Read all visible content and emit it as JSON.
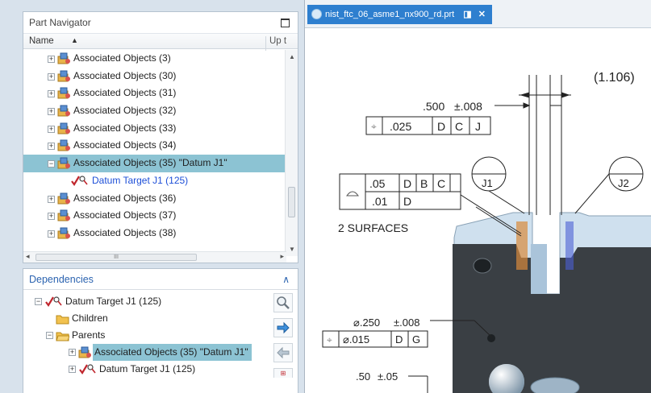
{
  "part_navigator": {
    "title": "Part Navigator",
    "columns": {
      "name": "Name",
      "sort_indicator": "▲",
      "up_to_date": "Up t"
    },
    "rows": [
      {
        "label": "Associated Objects (3)"
      },
      {
        "label": "Associated Objects (30)"
      },
      {
        "label": "Associated Objects (31)"
      },
      {
        "label": "Associated Objects (32)"
      },
      {
        "label": "Associated Objects (33)"
      },
      {
        "label": "Associated Objects (34)"
      },
      {
        "label": "Associated Objects (35) \"Datum J1\""
      },
      {
        "label": "Datum Target J1 (125)"
      },
      {
        "label": "Associated Objects (36)"
      },
      {
        "label": "Associated Objects (37)"
      },
      {
        "label": "Associated Objects (38)"
      }
    ],
    "hscroll_thumb": "III"
  },
  "dependencies": {
    "title": "Dependencies",
    "rows": [
      {
        "label": "Datum Target J1 (125)"
      },
      {
        "label": "Children"
      },
      {
        "label": "Parents"
      },
      {
        "label": "Associated Objects (35) \"Datum J1\""
      },
      {
        "label": "Datum Target J1 (125)"
      }
    ]
  },
  "editor": {
    "tab_title": "nist_ftc_06_asme1_nx900_rd.prt"
  },
  "drawing": {
    "dim_1106": "(1.106)",
    "dim_500": ".500",
    "tol_500": "±.008",
    "fcf1_value": ".025",
    "fcf1_d": "D",
    "fcf1_c": "C",
    "fcf1_j": "J",
    "fcf2_val1": ".05",
    "fcf2_d": "D",
    "fcf2_b": "B",
    "fcf2_c": "C",
    "fcf2_val2": ".01",
    "fcf2_d2": "D",
    "surfaces": "2 SURFACES",
    "j1": "J1",
    "j2": "J2",
    "dim_250": "⌀.250",
    "tol_250": "±.008",
    "fcf3_value": "⌀.015",
    "fcf3_d": "D",
    "fcf3_g": "G",
    "dim_50": ".50",
    "tol_50": "±.05"
  },
  "colors": {
    "selection": "#8cc3d3",
    "tab_blue": "#2e7fcf",
    "part_face": "#3a3f44",
    "part_highlight": "#cfe0ee"
  }
}
